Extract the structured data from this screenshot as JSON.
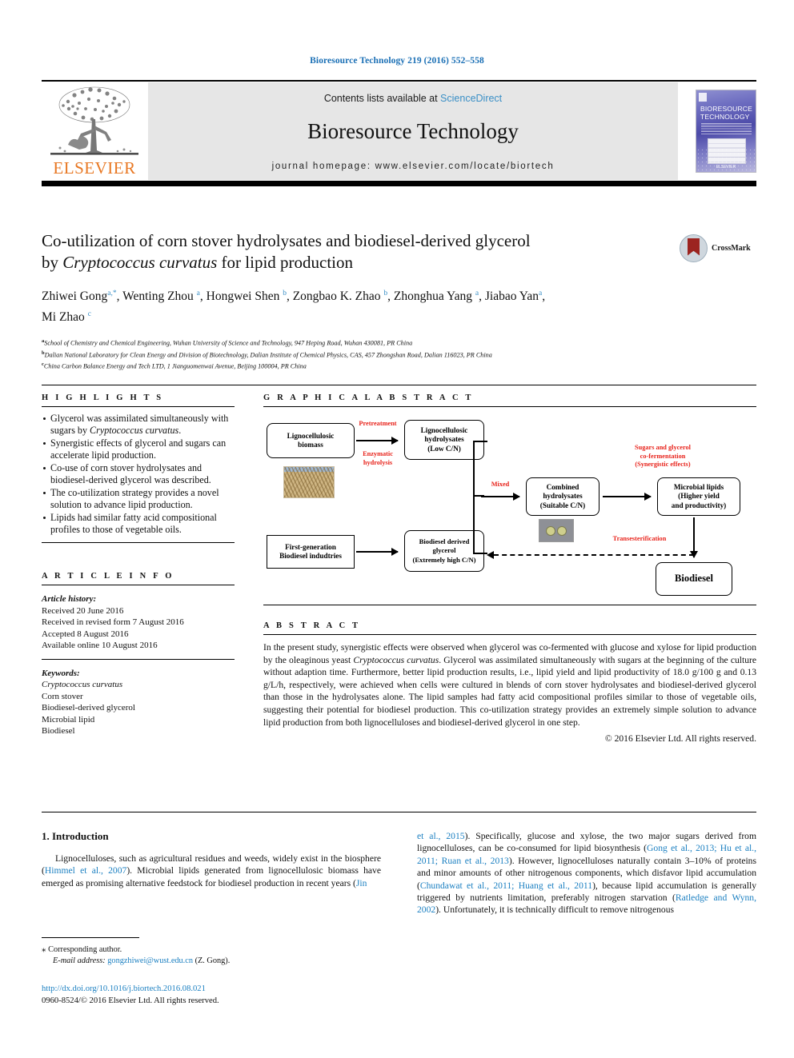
{
  "running_head": "Bioresource Technology 219 (2016) 552–558",
  "masthead": {
    "contents_prefix": "Contents lists available at ",
    "sciencedirect": "ScienceDirect",
    "journal_name": "Bioresource Technology",
    "homepage": "journal homepage: www.elsevier.com/locate/biortech",
    "publisher_name": "ELSEVIER",
    "cover_title": "BIORESOURCE TECHNOLOGY",
    "cover_footer": "ELSEVIER",
    "link_color": "#3a8fc6"
  },
  "article": {
    "title_line1": "Co-utilization of corn stover hydrolysates and biodiesel-derived glycerol",
    "title_line2_pre": "by ",
    "title_line2_italic": "Cryptococcus curvatus",
    "title_line2_post": " for lipid production",
    "crossmark_label": "CrossMark",
    "authors": [
      {
        "name": "Zhiwei Gong",
        "sup": "a,*"
      },
      {
        "name": "Wenting Zhou",
        "sup": "a"
      },
      {
        "name": "Hongwei Shen",
        "sup": "b"
      },
      {
        "name": "Zongbao K. Zhao",
        "sup": "b"
      },
      {
        "name": "Zhonghua Yang",
        "sup": "a"
      },
      {
        "name": "Jiabao Yan",
        "sup": "a"
      },
      {
        "name": "Mi Zhao",
        "sup": "c"
      }
    ],
    "affiliations": [
      {
        "mark": "a",
        "text": "School of Chemistry and Chemical Engineering, Wuhan University of Science and Technology, 947 Heping Road, Wuhan 430081, PR China"
      },
      {
        "mark": "b",
        "text": "Dalian National Laboratory for Clean Energy and Division of Biotechnology, Dalian Institute of Chemical Physics, CAS, 457 Zhongshan Road, Dalian 116023, PR China"
      },
      {
        "mark": "c",
        "text": "China Carbon Balance Energy and Tech LTD, 1 Jianguomenwai Avenue, Beijing 100004, PR China"
      }
    ]
  },
  "highlights": {
    "heading": "H I G H L I G H T S",
    "items": [
      {
        "pre": "Glycerol was assimilated simultaneously with sugars by ",
        "italic": "Cryptococcus curvatus",
        "post": "."
      },
      {
        "pre": "Synergistic effects of glycerol and sugars can accelerate lipid production.",
        "italic": "",
        "post": ""
      },
      {
        "pre": "Co-use of corn stover hydrolysates and biodiesel-derived glycerol was described.",
        "italic": "",
        "post": ""
      },
      {
        "pre": "The co-utilization strategy provides a novel solution to advance lipid production.",
        "italic": "",
        "post": ""
      },
      {
        "pre": "Lipids had similar fatty acid compositional profiles to those of vegetable oils.",
        "italic": "",
        "post": ""
      }
    ]
  },
  "graphical_abstract": {
    "heading": "G R A P H I C A L   A B S T R A C T",
    "boxes": [
      {
        "id": "lignobiomass",
        "text": "Lignocellulosic\nbiomass"
      },
      {
        "id": "lignohydro",
        "text": "Lignocellulosic\nhydrolysates\n(Low C/N)"
      },
      {
        "id": "firstgen",
        "text": "First-generation\nBiodiesel indudtries"
      },
      {
        "id": "bdglycerol",
        "text": "Biodiesel derived\nglycerol\n(Extremely high C/N)"
      },
      {
        "id": "combined",
        "text": "Combined\nhydrolysates\n(Suitable C/N)"
      },
      {
        "id": "microbial",
        "text": "Microbial lipids\n(Higher yield\nand productivity)"
      },
      {
        "id": "biodiesel",
        "text": "Biodiesel"
      }
    ],
    "labels": [
      {
        "id": "pretreatment",
        "text": "Pretreatment"
      },
      {
        "id": "enzymatic",
        "text": "Enzymatic\nhydrolysis"
      },
      {
        "id": "mixed",
        "text": "Mixed"
      },
      {
        "id": "cofermentation",
        "text": "Sugars and glycerol\nco-fermentation\n(Synergistic effects)"
      },
      {
        "id": "transesterification",
        "text": "Transesterification"
      }
    ],
    "label_color": "#e8231b"
  },
  "article_info": {
    "heading": "A R T I C L E   I N F O",
    "history_label": "Article history:",
    "history": [
      "Received 20 June 2016",
      "Received in revised form 7 August 2016",
      "Accepted 8 August 2016",
      "Available online 10 August 2016"
    ],
    "keywords_label": "Keywords:",
    "keywords": [
      "Cryptococcus curvatus",
      "Corn stover",
      "Biodiesel-derived glycerol",
      "Microbial lipid",
      "Biodiesel"
    ]
  },
  "abstract": {
    "heading": "A B S T R A C T",
    "part1": "In the present study, synergistic effects were observed when glycerol was co-fermented with glucose and xylose for lipid production by the oleaginous yeast ",
    "species": "Cryptococcus curvatus",
    "part2": ". Glycerol was assimilated simultaneously with sugars at the beginning of the culture without adaption time. Furthermore, better lipid production results, i.e., lipid yield and lipid productivity of 18.0 g/100 g and 0.13 g/L/h, respectively, were achieved when cells were cultured in blends of corn stover hydrolysates and biodiesel-derived glycerol than those in the hydrolysates alone. The lipid samples had fatty acid compositional profiles similar to those of vegetable oils, suggesting their potential for biodiesel production. This co-utilization strategy provides an extremely simple solution to advance lipid production from both lignocelluloses and biodiesel-derived glycerol in one step.",
    "copyright": "© 2016 Elsevier Ltd. All rights reserved."
  },
  "introduction": {
    "heading": "1. Introduction",
    "left_p1_a": "Lignocelluloses, such as agricultural residues and weeds, widely exist in the biosphere (",
    "left_ref1": "Himmel et al., 2007",
    "left_p1_b": "). Microbial lipids generated from lignocellulosic biomass have emerged as promising alternative feedstock for biodiesel production in recent years (",
    "left_ref2": "Jin",
    "right_ref_cont": "et al., 2015",
    "right_a": "). Specifically, glucose and xylose, the two major sugars derived from lignocelluloses, can be co-consumed for lipid biosynthesis (",
    "right_ref2": "Gong et al., 2013; Hu et al., 2011; Ruan et al., 2013",
    "right_b": "). However, lignocelluloses naturally contain 3–10% of proteins and minor amounts of other nitrogenous components, which disfavor lipid accumulation (",
    "right_ref3": "Chundawat et al., 2011; Huang et al., 2011",
    "right_c": "), because lipid accumulation is generally triggered by nutrients limitation, preferably nitrogen starvation (",
    "right_ref4": "Ratledge and Wynn, 2002",
    "right_d": "). Unfortunately, it is technically difficult to remove nitrogenous",
    "link_color": "#1a7fc1"
  },
  "footer": {
    "corresponding_star": "⁎",
    "corresponding_label": " Corresponding author.",
    "email_label": "E-mail address:",
    "email": "gongzhiwei@wust.edu.cn",
    "email_owner": "(Z. Gong).",
    "doi_url": "http://dx.doi.org/10.1016/j.biortech.2016.08.021",
    "issn_line": "0960-8524/© 2016 Elsevier Ltd. All rights reserved."
  }
}
